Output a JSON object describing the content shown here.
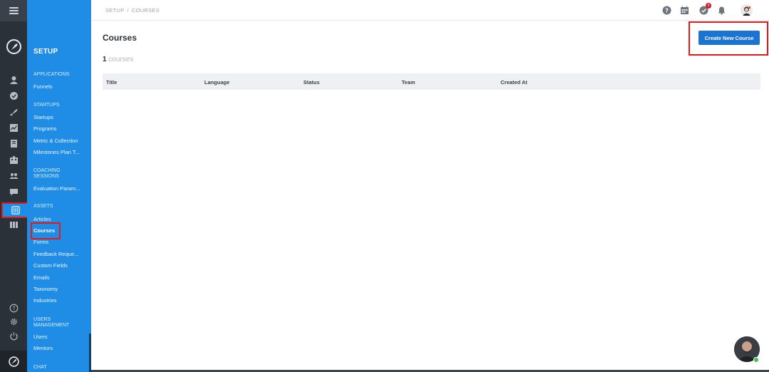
{
  "breadcrumb": {
    "root": "SETUP",
    "separator": "/",
    "current": "COURSES"
  },
  "sidebar": {
    "title": "SETUP",
    "sections": [
      {
        "label": "APPLICATIONS",
        "items": [
          "Funnels"
        ]
      },
      {
        "label": "STARTUPS",
        "items": [
          "Startups",
          "Programs",
          "Metric & Collection",
          "Milestones Plan T..."
        ]
      },
      {
        "label": "COACHING SESSIONS",
        "items": [
          "Evaluation Param..."
        ]
      },
      {
        "label": "ASSETS",
        "items": [
          "Articles",
          "Courses",
          "Forms",
          "Feedback Reque...",
          "Custom Fields",
          "Emails",
          "Taxonomy",
          "Industries"
        ]
      },
      {
        "label": "USERS MANAGEMENT",
        "items": [
          "Users",
          "Mentors"
        ]
      },
      {
        "label": "CHAT",
        "items": []
      }
    ],
    "active_item": "Courses"
  },
  "rail": {
    "icons": [
      "user-icon",
      "check-circle-icon",
      "rocket-icon",
      "chart-icon",
      "book-icon",
      "building-icon",
      "team-icon",
      "chat-icon",
      "settings-sliders-icon",
      "columns-icon"
    ],
    "bottom_icons": [
      "help-icon",
      "gear-icon",
      "power-icon"
    ]
  },
  "topbar": {
    "icons": [
      "help-icon",
      "calendar-icon",
      "tasks-icon",
      "bell-icon",
      "avatar"
    ],
    "tasks_badge": "0"
  },
  "main": {
    "title": "Courses",
    "count_number": "1",
    "count_label": "courses",
    "create_button": "Create New Course",
    "columns": [
      "Title",
      "Language",
      "Status",
      "Team",
      "Created At"
    ]
  },
  "colors": {
    "rail": "#2b3139",
    "sidebar": "#1f8ce6",
    "primary_button": "#1b74d1",
    "highlight": "#e11b1b"
  }
}
